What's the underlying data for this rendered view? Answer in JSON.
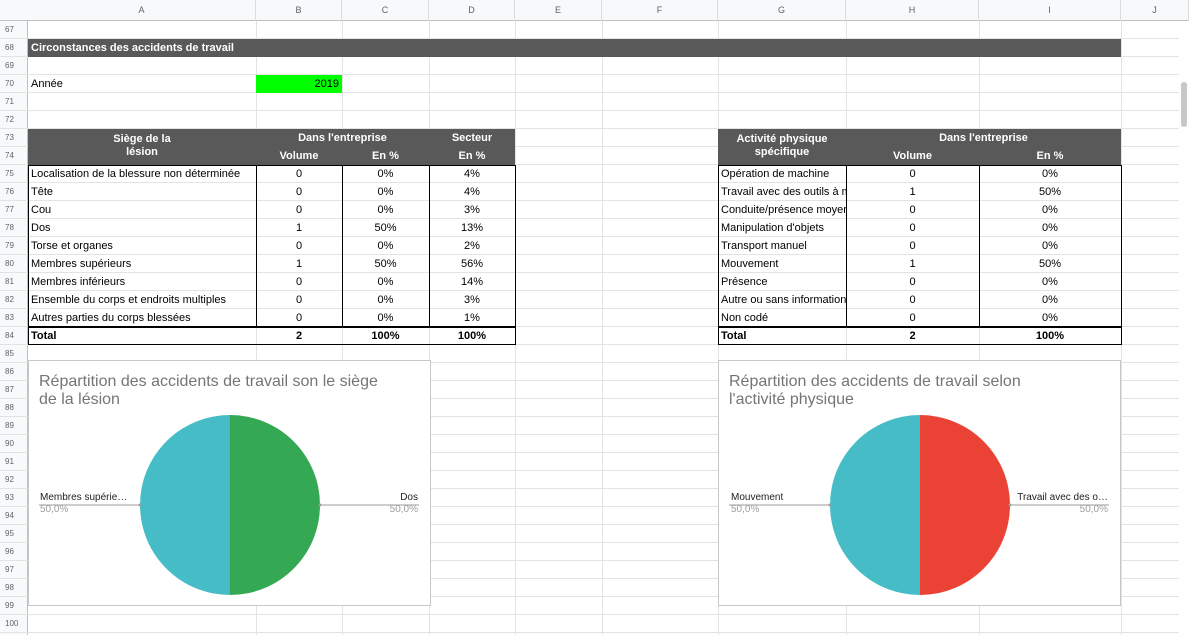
{
  "columns": [
    "A",
    "B",
    "C",
    "D",
    "E",
    "F",
    "G",
    "H",
    "I",
    "J"
  ],
  "rows": [
    "67",
    "68",
    "69",
    "70",
    "71",
    "72",
    "73",
    "74",
    "75",
    "76",
    "77",
    "78",
    "79",
    "80",
    "81",
    "82",
    "83",
    "84",
    "85",
    "86",
    "87",
    "88",
    "89",
    "90",
    "91",
    "92",
    "93",
    "94",
    "95",
    "96",
    "97",
    "98",
    "99",
    "100"
  ],
  "section_title": "Circonstances des accidents de travail",
  "year_label": "Année",
  "year_value": "2019",
  "year_color": "#00ff00",
  "left_table": {
    "col1_header": "Siège de la\nlésion",
    "group1": "Dans l'entreprise",
    "group2": "Secteur",
    "sub_volume": "Volume",
    "sub_pct1": "En %",
    "sub_pct2": "En %",
    "rows": [
      [
        "Localisation de la blessure non déterminée",
        "0",
        "0%",
        "4%"
      ],
      [
        "Tête",
        "0",
        "0%",
        "4%"
      ],
      [
        "Cou",
        "0",
        "0%",
        "3%"
      ],
      [
        "Dos",
        "1",
        "50%",
        "13%"
      ],
      [
        "Torse et organes",
        "0",
        "0%",
        "2%"
      ],
      [
        "Membres supérieurs",
        "1",
        "50%",
        "56%"
      ],
      [
        "Membres inférieurs",
        "0",
        "0%",
        "14%"
      ],
      [
        "Ensemble du corps et endroits multiples",
        "0",
        "0%",
        "3%"
      ],
      [
        "Autres parties du corps blessées",
        "0",
        "0%",
        "1%"
      ]
    ],
    "total": [
      "Total",
      "2",
      "100%",
      "100%"
    ]
  },
  "right_table": {
    "col1_header": "Activité physique\nspécifique",
    "group1": "Dans l'entreprise",
    "sub_volume": "Volume",
    "sub_pct": "En %",
    "rows": [
      [
        "Opération de machine",
        "0",
        "0%"
      ],
      [
        "Travail avec des outils à main",
        "1",
        "50%"
      ],
      [
        "Conduite/présence moyen de transport",
        "0",
        "0%"
      ],
      [
        "Manipulation d'objets",
        "0",
        "0%"
      ],
      [
        "Transport manuel",
        "0",
        "0%"
      ],
      [
        "Mouvement",
        "1",
        "50%"
      ],
      [
        "Présence",
        "0",
        "0%"
      ],
      [
        "Autre ou sans information",
        "0",
        "0%"
      ],
      [
        "Non codé",
        "0",
        "0%"
      ]
    ],
    "total": [
      "Total",
      "2",
      "100%"
    ]
  },
  "chart_data": [
    {
      "type": "pie",
      "title": "Répartition des accidents de travail son le siège\nde la lésion",
      "slices": [
        {
          "label": "Dos",
          "value": 50.0,
          "pct_text": "50,0%",
          "color": "#34a853"
        },
        {
          "label": "Membres supérie…",
          "value": 50.0,
          "pct_text": "50,0%",
          "color": "#46bdc6"
        }
      ]
    },
    {
      "type": "pie",
      "title": "Répartition des accidents de travail selon\nl'activité physique",
      "slices": [
        {
          "label": "Travail avec des o…",
          "value": 50.0,
          "pct_text": "50,0%",
          "color": "#ea4335"
        },
        {
          "label": "Mouvement",
          "value": 50.0,
          "pct_text": "50,0%",
          "color": "#46bdc6"
        }
      ]
    }
  ]
}
